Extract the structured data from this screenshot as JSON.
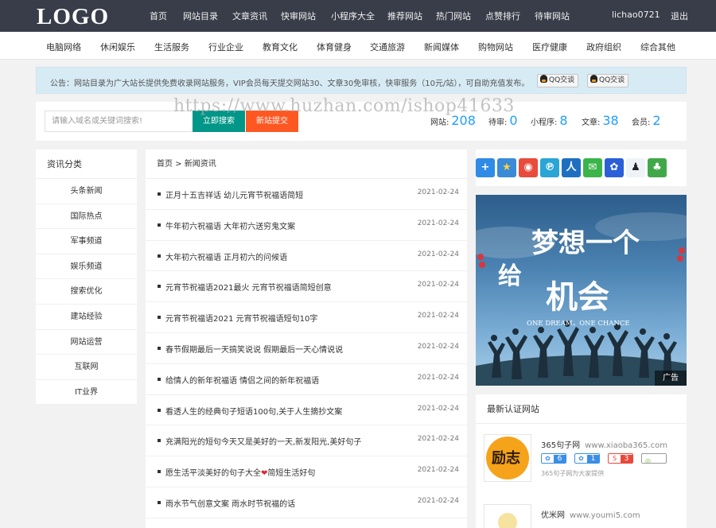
{
  "header": {
    "logo": "LOGO",
    "nav": [
      "首页",
      "网站目录",
      "文章资讯",
      "快审网站",
      "小程序大全",
      "推荐网站",
      "热门网站",
      "点赞排行",
      "待审网站"
    ],
    "username": "lichao0721",
    "logout": "退出"
  },
  "categories": [
    "电脑网络",
    "休闲娱乐",
    "生活服务",
    "行业企业",
    "教育文化",
    "体育健身",
    "交通旅游",
    "新闻媒体",
    "购物网站",
    "医疗健康",
    "政府组织",
    "综合其他"
  ],
  "notice": {
    "text": "公告：网站目录为广大站长提供免费收录网站服务，VIP会员每天提交网站30、文章30免审核，快审服务（10元/站），可自助充值发布。",
    "qq1": "QQ交谈",
    "qq2": "QQ交谈"
  },
  "search": {
    "placeholder": "请输入域名或关键词搜索!",
    "search_button": "立即搜索",
    "submit_button": "新站提交"
  },
  "stats": [
    {
      "label": "网站:",
      "value": "208"
    },
    {
      "label": "待审:",
      "value": "0"
    },
    {
      "label": "小程序:",
      "value": "8"
    },
    {
      "label": "文章:",
      "value": "38"
    },
    {
      "label": "会员:",
      "value": "2"
    }
  ],
  "watermark": "https://www.huzhan.com/ishop41633",
  "sidebar": {
    "title": "资讯分类",
    "items": [
      "头条新闻",
      "国际热点",
      "军事频道",
      "娱乐频道",
      "搜索优化",
      "建站经验",
      "网站运营",
      "互联网",
      "IT业界"
    ]
  },
  "breadcrumb": "首页 > 新闻资讯",
  "articles": [
    {
      "title": "正月十五吉祥话 幼儿元宵节祝福语简短",
      "date": "2021-02-24"
    },
    {
      "title": "牛年初六祝福语 大年初六送穷鬼文案",
      "date": "2021-02-24"
    },
    {
      "title": "大年初六祝福语 正月初六的问候语",
      "date": "2021-02-24"
    },
    {
      "title": "元宵节祝福语2021最火 元宵节祝福语简短创意",
      "date": "2021-02-24"
    },
    {
      "title": "元宵节祝福语2021 元宵节祝福语短句10字",
      "date": "2021-02-24"
    },
    {
      "title": "春节假期最后一天搞笑说说 假期最后一天心情说说",
      "date": "2021-02-24"
    },
    {
      "title": "给情人的新年祝福语 情侣之间的新年祝福语",
      "date": "2021-02-24"
    },
    {
      "title": "看透人生的经典句子短语100句,关于人生摘抄文案",
      "date": "2021-02-24"
    },
    {
      "title": "充满阳光的短句今天又是美好的一天,新发阳光,美好句子",
      "date": "2021-02-24"
    },
    {
      "title_a": "愿生活平淡美好的句子大全",
      "title_b": "简短生活好句",
      "date": "2021-02-24"
    },
    {
      "title": "雨水节气创意文案 雨水时节祝福的话",
      "date": "2021-02-24"
    }
  ],
  "share_icons": [
    "plus-icon",
    "star-icon",
    "weibo-icon",
    "tencent-weibo-icon",
    "renren-icon",
    "wechat-icon",
    "baidu-icon",
    "qq-icon",
    "clover-icon"
  ],
  "banner": {
    "line1": "梦想一个",
    "prefix": "给",
    "line2": "机会",
    "english": "ONE DREAM，ONE CHANCE",
    "ad_tag": "广告"
  },
  "certified": {
    "title": "最新认证网站",
    "sites": [
      {
        "name": "365句子网",
        "url": "www.xiaoba365.com",
        "thumb": "励志",
        "badges": [
          "6",
          "1",
          "3",
          ""
        ],
        "desc": "365句子网为大家提供"
      },
      {
        "name": "优米网",
        "url": "www.youmi5.com"
      }
    ]
  },
  "colors": {
    "topbar": "#393d49",
    "search_button": "#009688",
    "submit_button": "#ff5722",
    "stat_number": "#1e9fff",
    "notice_bg": "#d7ebf5"
  }
}
